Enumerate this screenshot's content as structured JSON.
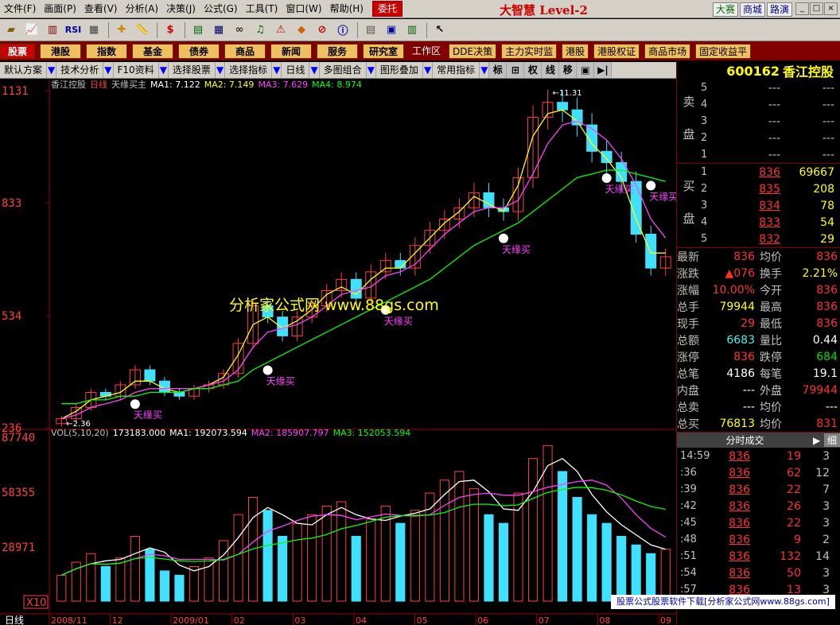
{
  "menu": [
    "文件(F)",
    "画面(P)",
    "查看(V)",
    "分析(A)",
    "决策(J)",
    "公式(G)",
    "工具(T)",
    "窗口(W)",
    "帮助(H)"
  ],
  "trade_button": "委托",
  "brand": "大智慧 Level-2",
  "right_buttons": [
    "大赛",
    "商城",
    "路演"
  ],
  "nav": [
    "股票",
    "港股",
    "指数",
    "基金",
    "债券",
    "商品",
    "新闻",
    "服务",
    "研究室",
    "工作区",
    "DDE决策",
    "主力实时监",
    "港股",
    "港股权证",
    "商品市场",
    "固定收益平"
  ],
  "subbar": [
    "默认方案",
    "技术分析",
    "F10资料",
    "选择股票",
    "选择指标",
    "日线",
    "多图组合",
    "图形叠加",
    "常用指标"
  ],
  "subbar_icons": [
    "标",
    "⊞",
    "权",
    "线",
    "移",
    "▣",
    "▶|"
  ],
  "stock": {
    "code": "600162",
    "name": "香江控股"
  },
  "chart_header": {
    "stock": "香江控股",
    "period": "日线",
    "indicator": "天缘买主",
    "ma1": "MA1: 7.122",
    "ma2": "MA2: 7.149",
    "ma3": "MA3: 7.629",
    "ma4": "MA4: 8.974"
  },
  "vol_header": {
    "name": "VOL(5,10,20)",
    "value": "173183.000",
    "ma1": "MA1: 192073.594",
    "ma2": "MA2: 185907.797",
    "ma3": "MA3: 152053.594"
  },
  "watermark": "分析家公式网 www.88gs.com",
  "annotation_label": "天缘买",
  "peak_label": "11.31",
  "low_label": "2.36",
  "chart_data": {
    "type": "line",
    "title": "香江控股 日线",
    "price_axis_labels": [
      "1131",
      "833",
      "534",
      "236"
    ],
    "price_ylim": [
      2.36,
      11.31
    ],
    "vol_axis_labels": [
      "87740",
      "58355",
      "28971"
    ],
    "vol_multiplier": "X10",
    "x_labels": [
      "2008/11",
      "12",
      "2009/01",
      "02",
      "03",
      "04",
      "05",
      "06",
      "07",
      "08",
      "09"
    ],
    "close": [
      2.6,
      2.9,
      3.3,
      3.2,
      3.5,
      3.9,
      3.6,
      3.3,
      3.2,
      3.4,
      3.5,
      3.8,
      4.6,
      5.6,
      5.3,
      4.8,
      5.3,
      5.6,
      6.0,
      6.3,
      5.8,
      6.5,
      6.8,
      6.6,
      7.2,
      7.6,
      7.9,
      8.2,
      8.6,
      8.2,
      8.1,
      9.0,
      10.6,
      11.0,
      10.8,
      10.4,
      9.7,
      9.4,
      8.9,
      7.5,
      6.6,
      6.9
    ],
    "ma_short": [
      2.6,
      2.8,
      3.1,
      3.2,
      3.3,
      3.6,
      3.6,
      3.4,
      3.3,
      3.4,
      3.5,
      3.7,
      4.3,
      5.1,
      5.3,
      5.0,
      5.2,
      5.5,
      5.9,
      6.1,
      5.9,
      6.3,
      6.6,
      6.6,
      7.0,
      7.4,
      7.8,
      8.1,
      8.5,
      8.3,
      8.1,
      8.8,
      10.1,
      10.7,
      10.8,
      10.5,
      9.9,
      9.5,
      9.0,
      7.9,
      7.0,
      7.0
    ],
    "ma_mid": [
      2.6,
      2.7,
      2.9,
      3.0,
      3.1,
      3.3,
      3.4,
      3.4,
      3.4,
      3.4,
      3.5,
      3.6,
      3.9,
      4.5,
      4.9,
      5.0,
      5.1,
      5.3,
      5.6,
      5.9,
      6.0,
      6.1,
      6.4,
      6.5,
      6.7,
      7.1,
      7.5,
      7.8,
      8.1,
      8.2,
      8.2,
      8.4,
      9.1,
      9.9,
      10.4,
      10.5,
      10.3,
      10.0,
      9.5,
      8.8,
      7.9,
      7.4
    ],
    "ma_long": [
      3.0,
      3.0,
      3.1,
      3.1,
      3.2,
      3.2,
      3.3,
      3.3,
      3.3,
      3.4,
      3.4,
      3.5,
      3.6,
      3.9,
      4.1,
      4.3,
      4.5,
      4.7,
      4.9,
      5.1,
      5.3,
      5.5,
      5.7,
      5.9,
      6.1,
      6.3,
      6.6,
      6.9,
      7.2,
      7.4,
      7.6,
      7.8,
      8.1,
      8.4,
      8.7,
      9.0,
      9.1,
      9.2,
      9.2,
      9.1,
      9.0,
      8.9
    ],
    "signals": [
      5,
      14,
      22,
      30,
      37,
      40
    ],
    "volume": [
      12,
      18,
      22,
      16,
      20,
      30,
      24,
      14,
      12,
      16,
      20,
      28,
      40,
      48,
      42,
      30,
      36,
      40,
      44,
      46,
      30,
      38,
      44,
      36,
      42,
      50,
      56,
      60,
      52,
      40,
      36,
      50,
      66,
      72,
      60,
      48,
      40,
      36,
      30,
      26,
      22,
      24
    ],
    "vol_ylim": [
      0,
      87740
    ]
  },
  "orderbook": {
    "sell_label": [
      "卖",
      "盘"
    ],
    "buy_label": [
      "买",
      "盘"
    ],
    "sell": [
      {
        "lv": "5",
        "p": "---",
        "v": "---"
      },
      {
        "lv": "4",
        "p": "---",
        "v": "---"
      },
      {
        "lv": "3",
        "p": "---",
        "v": "---"
      },
      {
        "lv": "2",
        "p": "---",
        "v": "---"
      },
      {
        "lv": "1",
        "p": "---",
        "v": "---"
      }
    ],
    "buy": [
      {
        "lv": "1",
        "p": "836",
        "v": "69667"
      },
      {
        "lv": "2",
        "p": "835",
        "v": "208"
      },
      {
        "lv": "3",
        "p": "834",
        "v": "78"
      },
      {
        "lv": "4",
        "p": "833",
        "v": "54"
      },
      {
        "lv": "5",
        "p": "832",
        "v": "29"
      }
    ]
  },
  "stats": [
    {
      "k1": "最新",
      "v1": "836",
      "c1": "red",
      "k2": "均价",
      "v2": "836",
      "c2": "red"
    },
    {
      "k1": "涨跌",
      "v1": "▲076",
      "c1": "red",
      "k2": "换手",
      "v2": "2.21%",
      "c2": "yel"
    },
    {
      "k1": "涨幅",
      "v1": "10.00%",
      "c1": "red",
      "k2": "今开",
      "v2": "836",
      "c2": "red"
    },
    {
      "k1": "总手",
      "v1": "79944",
      "c1": "yel",
      "k2": "最高",
      "v2": "836",
      "c2": "red"
    },
    {
      "k1": "现手",
      "v1": "29",
      "c1": "red",
      "k2": "最低",
      "v2": "836",
      "c2": "red"
    },
    {
      "k1": "总额",
      "v1": "6683",
      "c1": "cyn",
      "k2": "量比",
      "v2": "0.44",
      "c2": "wht"
    },
    {
      "k1": "涨停",
      "v1": "836",
      "c1": "red",
      "k2": "跌停",
      "v2": "684",
      "c2": "grn"
    },
    {
      "k1": "总笔",
      "v1": "4186",
      "c1": "wht",
      "k2": "每笔",
      "v2": "19.1",
      "c2": "wht"
    },
    {
      "k1": "内盘",
      "v1": "---",
      "c1": "wht",
      "k2": "外盘",
      "v2": "79944",
      "c2": "red"
    },
    {
      "k1": "总卖",
      "v1": "---",
      "c1": "wht",
      "k2": "均价",
      "v2": "---",
      "c2": "wht"
    },
    {
      "k1": "总买",
      "v1": "76813",
      "c1": "yel",
      "k2": "均价",
      "v2": "831",
      "c2": "red"
    }
  ],
  "ticks_header": {
    "title": "分时成交",
    "more": "细"
  },
  "ticks": [
    {
      "t": "14:59",
      "p": "836",
      "v": "19",
      "c": "3"
    },
    {
      "t": ":36",
      "p": "836",
      "v": "62",
      "c": "12"
    },
    {
      "t": ":39",
      "p": "836",
      "v": "22",
      "c": "7"
    },
    {
      "t": ":42",
      "p": "836",
      "v": "26",
      "c": "3"
    },
    {
      "t": ":45",
      "p": "836",
      "v": "22",
      "c": "3"
    },
    {
      "t": ":48",
      "p": "836",
      "v": "9",
      "c": "2"
    },
    {
      "t": ":51",
      "p": "836",
      "v": "132",
      "c": "14"
    },
    {
      "t": ":54",
      "p": "836",
      "v": "50",
      "c": "3"
    },
    {
      "t": ":57",
      "p": "836",
      "v": "13",
      "c": "3"
    }
  ],
  "footer": "股票公式股票软件下载[分析家公式网www.88gs.com]",
  "colors": {
    "up": "#ff3030",
    "ma1": "#ffffff",
    "ma2": "#ffff00",
    "ma3": "#ff40ff",
    "ma4": "#00ff00"
  }
}
